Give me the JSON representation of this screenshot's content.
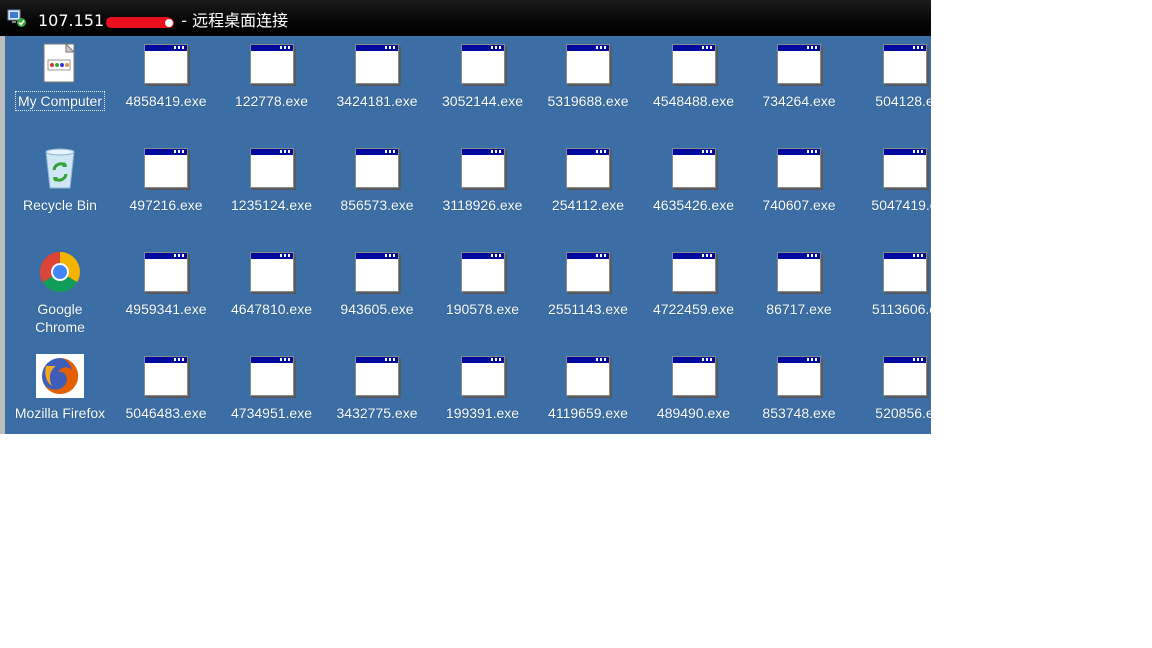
{
  "window": {
    "title_prefix": "107.151",
    "title_suffix": " - 远程桌面连接"
  },
  "colors": {
    "desktop": "#3a6ea5",
    "titlebar": "#000000",
    "exe_bar": "#000a9e"
  },
  "system_icons": [
    {
      "label": "My Computer",
      "icon": "my-computer-icon"
    },
    {
      "label": "Recycle Bin",
      "icon": "recycle-bin-icon"
    },
    {
      "label": "Google\nChrome",
      "icon": "chrome-icon"
    },
    {
      "label": "Mozilla Firefox",
      "icon": "firefox-icon"
    }
  ],
  "exe_rows": [
    [
      "4858419.exe",
      "122778.exe",
      "3424181.exe",
      "3052144.exe",
      "5319688.exe",
      "4548488.exe",
      "734264.exe",
      "504128.e"
    ],
    [
      "497216.exe",
      "1235124.exe",
      "856573.exe",
      "3118926.exe",
      "254112.exe",
      "4635426.exe",
      "740607.exe",
      "5047419.e"
    ],
    [
      "4959341.exe",
      "4647810.exe",
      "943605.exe",
      "190578.exe",
      "2551143.exe",
      "4722459.exe",
      "86717.exe",
      "5113606.e"
    ],
    [
      "5046483.exe",
      "4734951.exe",
      "3432775.exe",
      "199391.exe",
      "4119659.exe",
      "489490.exe",
      "853748.exe",
      "520856.e"
    ]
  ]
}
